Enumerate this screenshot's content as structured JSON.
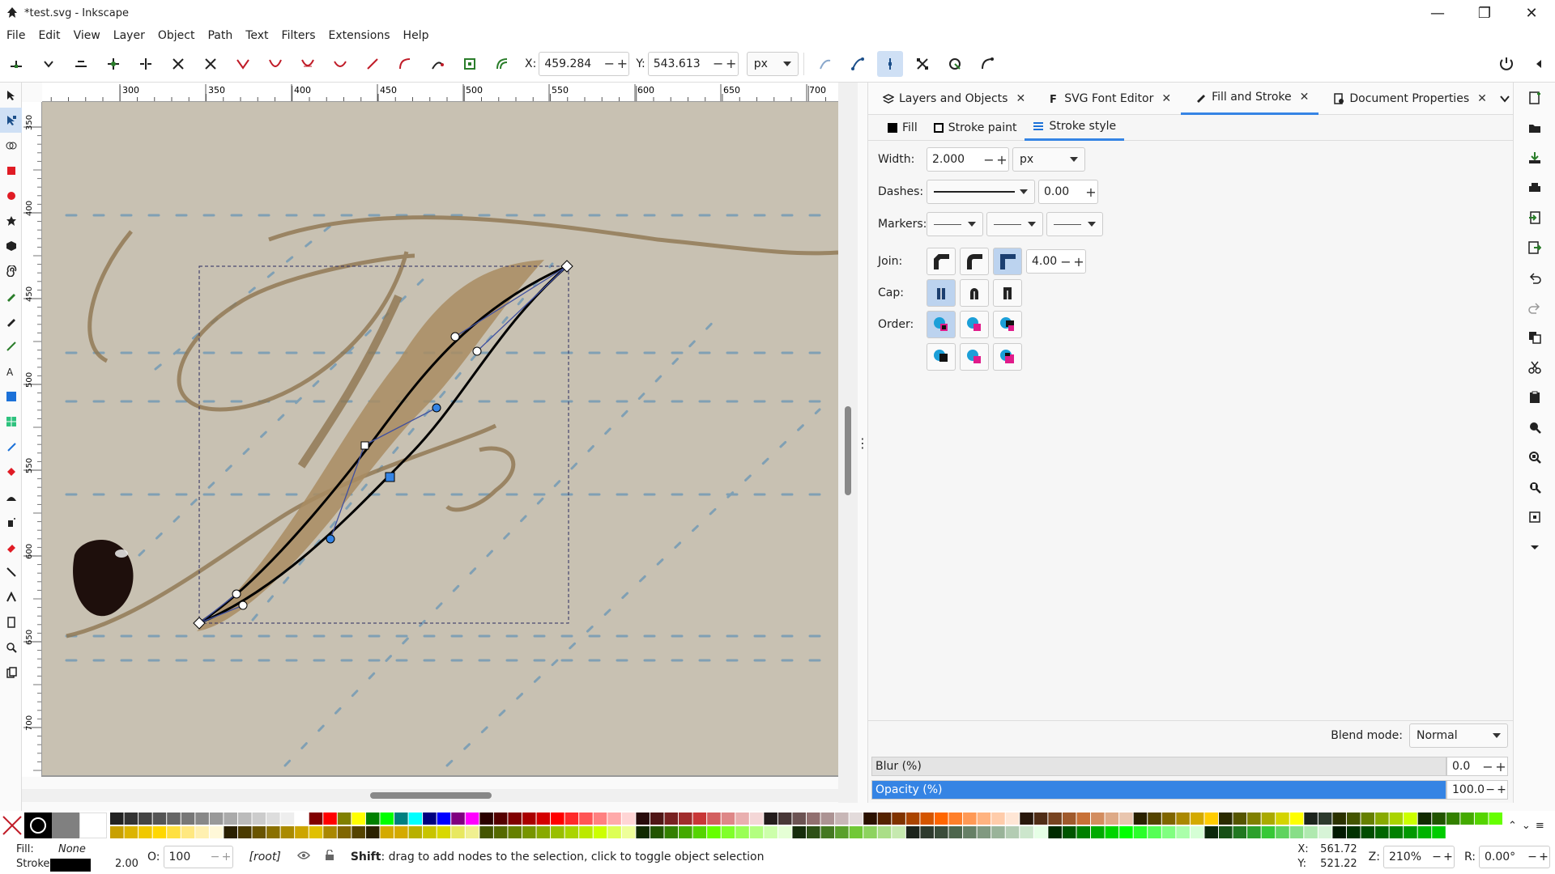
{
  "window": {
    "title": "*test.svg - Inkscape",
    "minimize": "—",
    "maximize": "❐",
    "close": "✕"
  },
  "menu": [
    "File",
    "Edit",
    "View",
    "Layer",
    "Object",
    "Path",
    "Text",
    "Filters",
    "Extensions",
    "Help"
  ],
  "node_toolbar": {
    "x_label": "X:",
    "x_value": "459.284",
    "y_label": "Y:",
    "y_value": "543.613",
    "unit": "px"
  },
  "rulers": {
    "h_ticks": [
      "300",
      "350",
      "400",
      "450",
      "500",
      "550",
      "600",
      "650",
      "700"
    ],
    "v_ticks": [
      "350",
      "400",
      "450",
      "500",
      "550",
      "600",
      "650",
      "700"
    ]
  },
  "dialog_tabs": [
    {
      "label": "Layers and Objects",
      "active": false
    },
    {
      "label": "SVG Font Editor",
      "active": false
    },
    {
      "label": "Fill and Stroke",
      "active": true
    },
    {
      "label": "Document Properties",
      "active": false
    }
  ],
  "subtabs": [
    {
      "label": "Fill",
      "active": false
    },
    {
      "label": "Stroke paint",
      "active": false
    },
    {
      "label": "Stroke style",
      "active": true
    }
  ],
  "stroke_style": {
    "width_label": "Width:",
    "width_value": "2.000",
    "width_unit": "px",
    "dashes_label": "Dashes:",
    "dash_offset": "0.00",
    "markers_label": "Markers:",
    "join_label": "Join:",
    "miter_limit": "4.00",
    "cap_label": "Cap:",
    "order_label": "Order:"
  },
  "blend": {
    "label": "Blend mode:",
    "value": "Normal"
  },
  "blur": {
    "label": "Blur (%)",
    "value": "0.0"
  },
  "opacity": {
    "label": "Opacity (%)",
    "value": "100.0",
    "level": 1.0
  },
  "status": {
    "fill_label": "Fill:",
    "fill_value": "None",
    "stroke_label": "Stroke:",
    "stroke_width": "2.00",
    "opacity_label": "O:",
    "opacity_value": "100",
    "layer": "[root]",
    "message_bold": "Shift",
    "message": ": drag to add nodes to the selection, click to toggle object selection",
    "cursor_x_label": "X:",
    "cursor_x": "561.72",
    "cursor_y_label": "Y:",
    "cursor_y": "521.22",
    "zoom_label": "Z:",
    "zoom": "210%",
    "rotate_label": "R:",
    "rotate": "0.00°"
  },
  "colors": {
    "accent": "#3584e4",
    "selection_fill": "#cfe0f5"
  }
}
